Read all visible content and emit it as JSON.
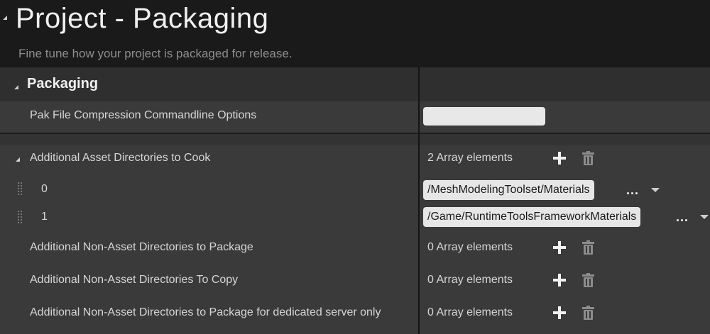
{
  "header": {
    "title": "Project - Packaging",
    "subtitle": "Fine tune how your project is packaged for release."
  },
  "section": {
    "title": "Packaging"
  },
  "rows": {
    "pak": {
      "label": "Pak File Compression Commandline Options",
      "value": ""
    },
    "cook": {
      "label": "Additional Asset Directories to Cook",
      "count": "2 Array elements",
      "items": [
        {
          "index": "0",
          "path": "/MeshModelingToolset/Materials",
          "more": "..."
        },
        {
          "index": "1",
          "path": "/Game/RuntimeToolsFrameworkMaterials",
          "more": "..."
        }
      ]
    },
    "non_asset_package": {
      "label": "Additional Non-Asset Directories to Package",
      "count": "0 Array elements"
    },
    "non_asset_copy": {
      "label": "Additional Non-Asset Directories To Copy",
      "count": "0 Array elements"
    },
    "non_asset_server": {
      "label": "Additional Non-Asset Directories to Package for dedicated server only",
      "count": "0 Array elements"
    }
  },
  "icons": {
    "add": "plus-icon",
    "remove": "trash-icon",
    "expand": "triangle-down-icon",
    "drag": "drag-handle-icon",
    "dropdown": "chevron-down-icon"
  }
}
